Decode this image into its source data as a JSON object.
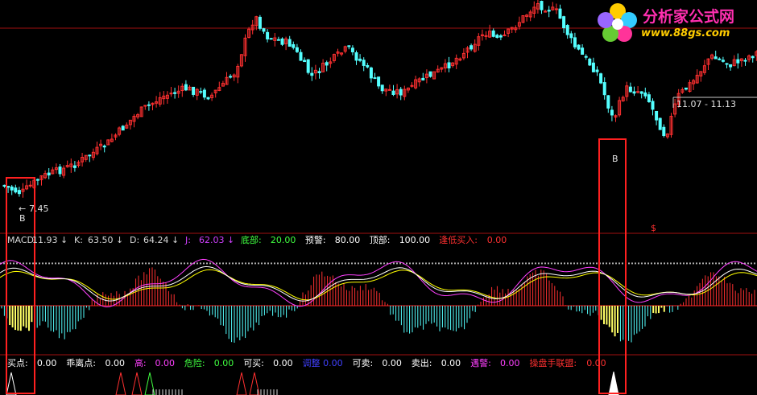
{
  "logo": {
    "title": "分析家公式网",
    "url": "www.88gs.com"
  },
  "colors": {
    "up": "#ff3030",
    "down": "#54ffff",
    "kline_k": "#ffffff",
    "kline_d": "#ffff00",
    "kline_j": "#ff40ff",
    "highlight_box": "#ff2020",
    "bar_highlight": "#ffff66"
  },
  "chart_data": [
    {
      "type": "candlestick",
      "name": "price",
      "annotations": {
        "low_marker": "7.45",
        "buy_signal_1": "B",
        "buy_signal_2": "B",
        "date_range": "11.07 - 11.13"
      }
    },
    {
      "type": "line",
      "name": "indicator",
      "labels": [
        {
          "key": "MACD",
          "text": "MACD",
          "value": "11.93",
          "arrow": "↓",
          "color": "#d8d8d8"
        },
        {
          "key": "K",
          "text": "K:",
          "value": "63.50",
          "arrow": "↓",
          "color": "#d8d8d8"
        },
        {
          "key": "D",
          "text": "D:",
          "value": "64.24",
          "arrow": "↓",
          "color": "#d8d8d8"
        },
        {
          "key": "J",
          "text": "J:",
          "value": "62.03",
          "arrow": "↓",
          "color": "#d040ff"
        },
        {
          "key": "bottom",
          "text": "底部:",
          "value": "20.00",
          "arrow": "",
          "color": "#40ff40"
        },
        {
          "key": "warn",
          "text": "预警:",
          "value": "80.00",
          "arrow": "",
          "color": "#ffffff"
        },
        {
          "key": "top",
          "text": "顶部:",
          "value": "100.00",
          "arrow": "",
          "color": "#ffffff"
        },
        {
          "key": "lowbuy",
          "text": "逢低买入:",
          "value": "0.00",
          "arrow": "",
          "color": "#ff3030"
        }
      ],
      "signal_mark": "$"
    },
    {
      "type": "bar",
      "name": "signals",
      "labels": [
        {
          "key": "buy",
          "text": "买点:",
          "value": "0.00",
          "color": "#ffffff"
        },
        {
          "key": "diverge",
          "text": "乖离点:",
          "value": "0.00",
          "color": "#ffffff"
        },
        {
          "key": "high",
          "text": "高:",
          "value": "0.00",
          "color": "#ff40ff"
        },
        {
          "key": "danger",
          "text": "危险:",
          "value": "0.00",
          "color": "#40ff40"
        },
        {
          "key": "canbuy",
          "text": "可买:",
          "value": "0.00",
          "color": "#ffffff"
        },
        {
          "key": "adjust",
          "text": "调整",
          "value": "0.00",
          "color": "#4040ff"
        },
        {
          "key": "cansell",
          "text": "可卖:",
          "value": "0.00",
          "color": "#ffffff"
        },
        {
          "key": "sell",
          "text": "卖出:",
          "value": "0.00",
          "color": "#ffffff"
        },
        {
          "key": "alert",
          "text": "遇警:",
          "value": "0.00",
          "color": "#ff40ff"
        },
        {
          "key": "trader",
          "text": "操盘手联盟:",
          "value": "0.00",
          "color": "#ff3030"
        }
      ]
    }
  ]
}
